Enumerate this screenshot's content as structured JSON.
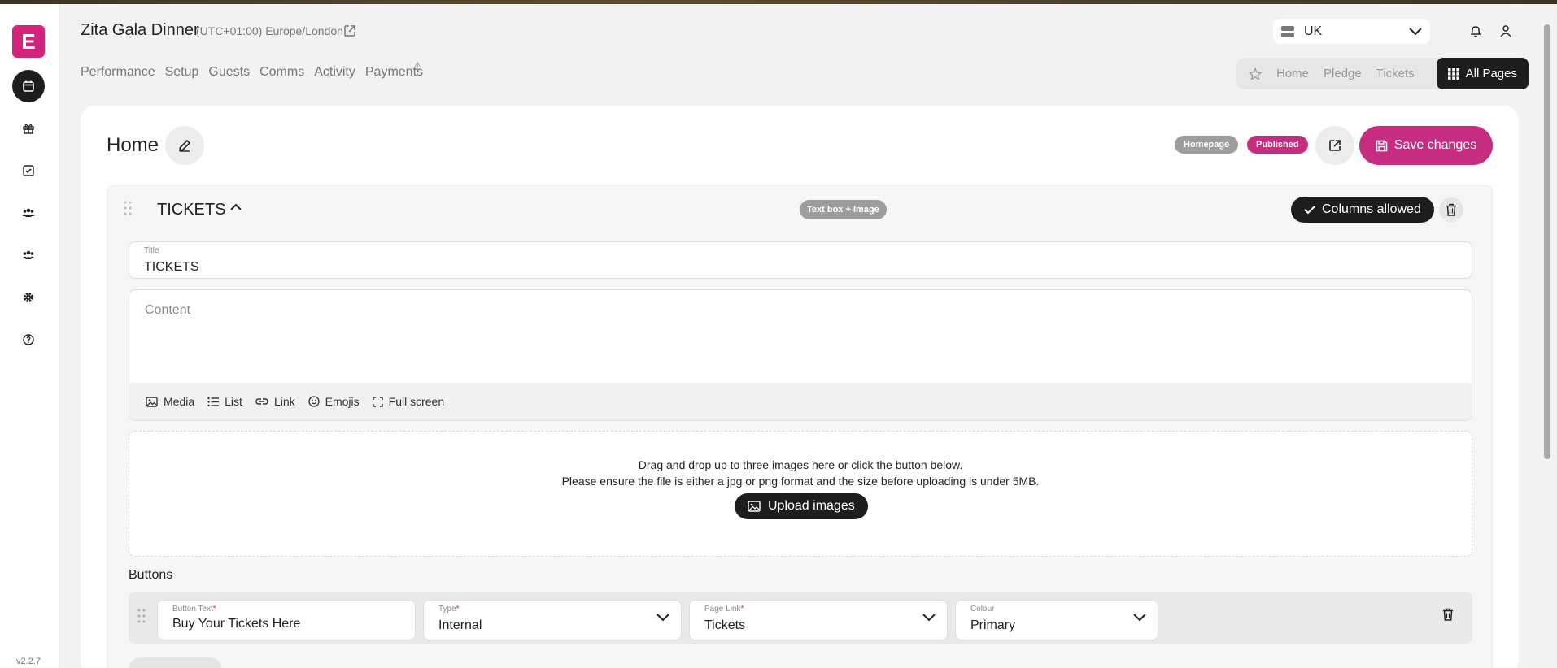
{
  "app": {
    "logo_letter": "E",
    "version": "v2.2.7",
    "brand_color": "#d4237a"
  },
  "sidebar": {
    "items": [
      {
        "icon": "calendar-icon",
        "active": true
      },
      {
        "icon": "gift-icon"
      },
      {
        "icon": "checkbox-icon"
      },
      {
        "icon": "group-icon"
      },
      {
        "icon": "users-icon"
      },
      {
        "icon": "gear-icon"
      },
      {
        "icon": "help-icon"
      }
    ]
  },
  "header": {
    "event_title": "Zita Gala Dinner",
    "timezone": "(UTC+01:00) Europe/London",
    "nav": [
      "Performance",
      "Setup",
      "Guests",
      "Comms",
      "Activity",
      "Payments"
    ],
    "payments_warning": "⚠",
    "region": "UK",
    "page_tabs": [
      "Home",
      "Pledge",
      "Tickets"
    ],
    "all_pages_label": "All Pages"
  },
  "page": {
    "title": "Home",
    "badge_homepage": "Homepage",
    "badge_published": "Published",
    "save_label": "Save changes"
  },
  "section": {
    "title": "TICKETS",
    "type_label": "Text box + Image",
    "columns_label": "Columns allowed",
    "title_field": {
      "label": "Title",
      "value": "TICKETS"
    },
    "content_placeholder": "Content",
    "toolbar": {
      "media": "Media",
      "list": "List",
      "link": "Link",
      "emojis": "Emojis",
      "fullscreen": "Full screen"
    },
    "dropzone": {
      "line1": "Drag and drop up to three images here or click the button below.",
      "line2": "Please ensure the file is either a jpg or png format and the size before uploading is under 5MB.",
      "upload_label": "Upload images"
    },
    "buttons_heading": "Buttons",
    "button_row": {
      "button_text": {
        "label": "Button Text",
        "required": "*",
        "value": "Buy Your Tickets Here"
      },
      "type": {
        "label": "Type",
        "required": "*",
        "value": "Internal"
      },
      "page_link": {
        "label": "Page Link",
        "required": "*",
        "value": "Tickets"
      },
      "colour": {
        "label": "Colour",
        "value": "Primary"
      }
    }
  }
}
